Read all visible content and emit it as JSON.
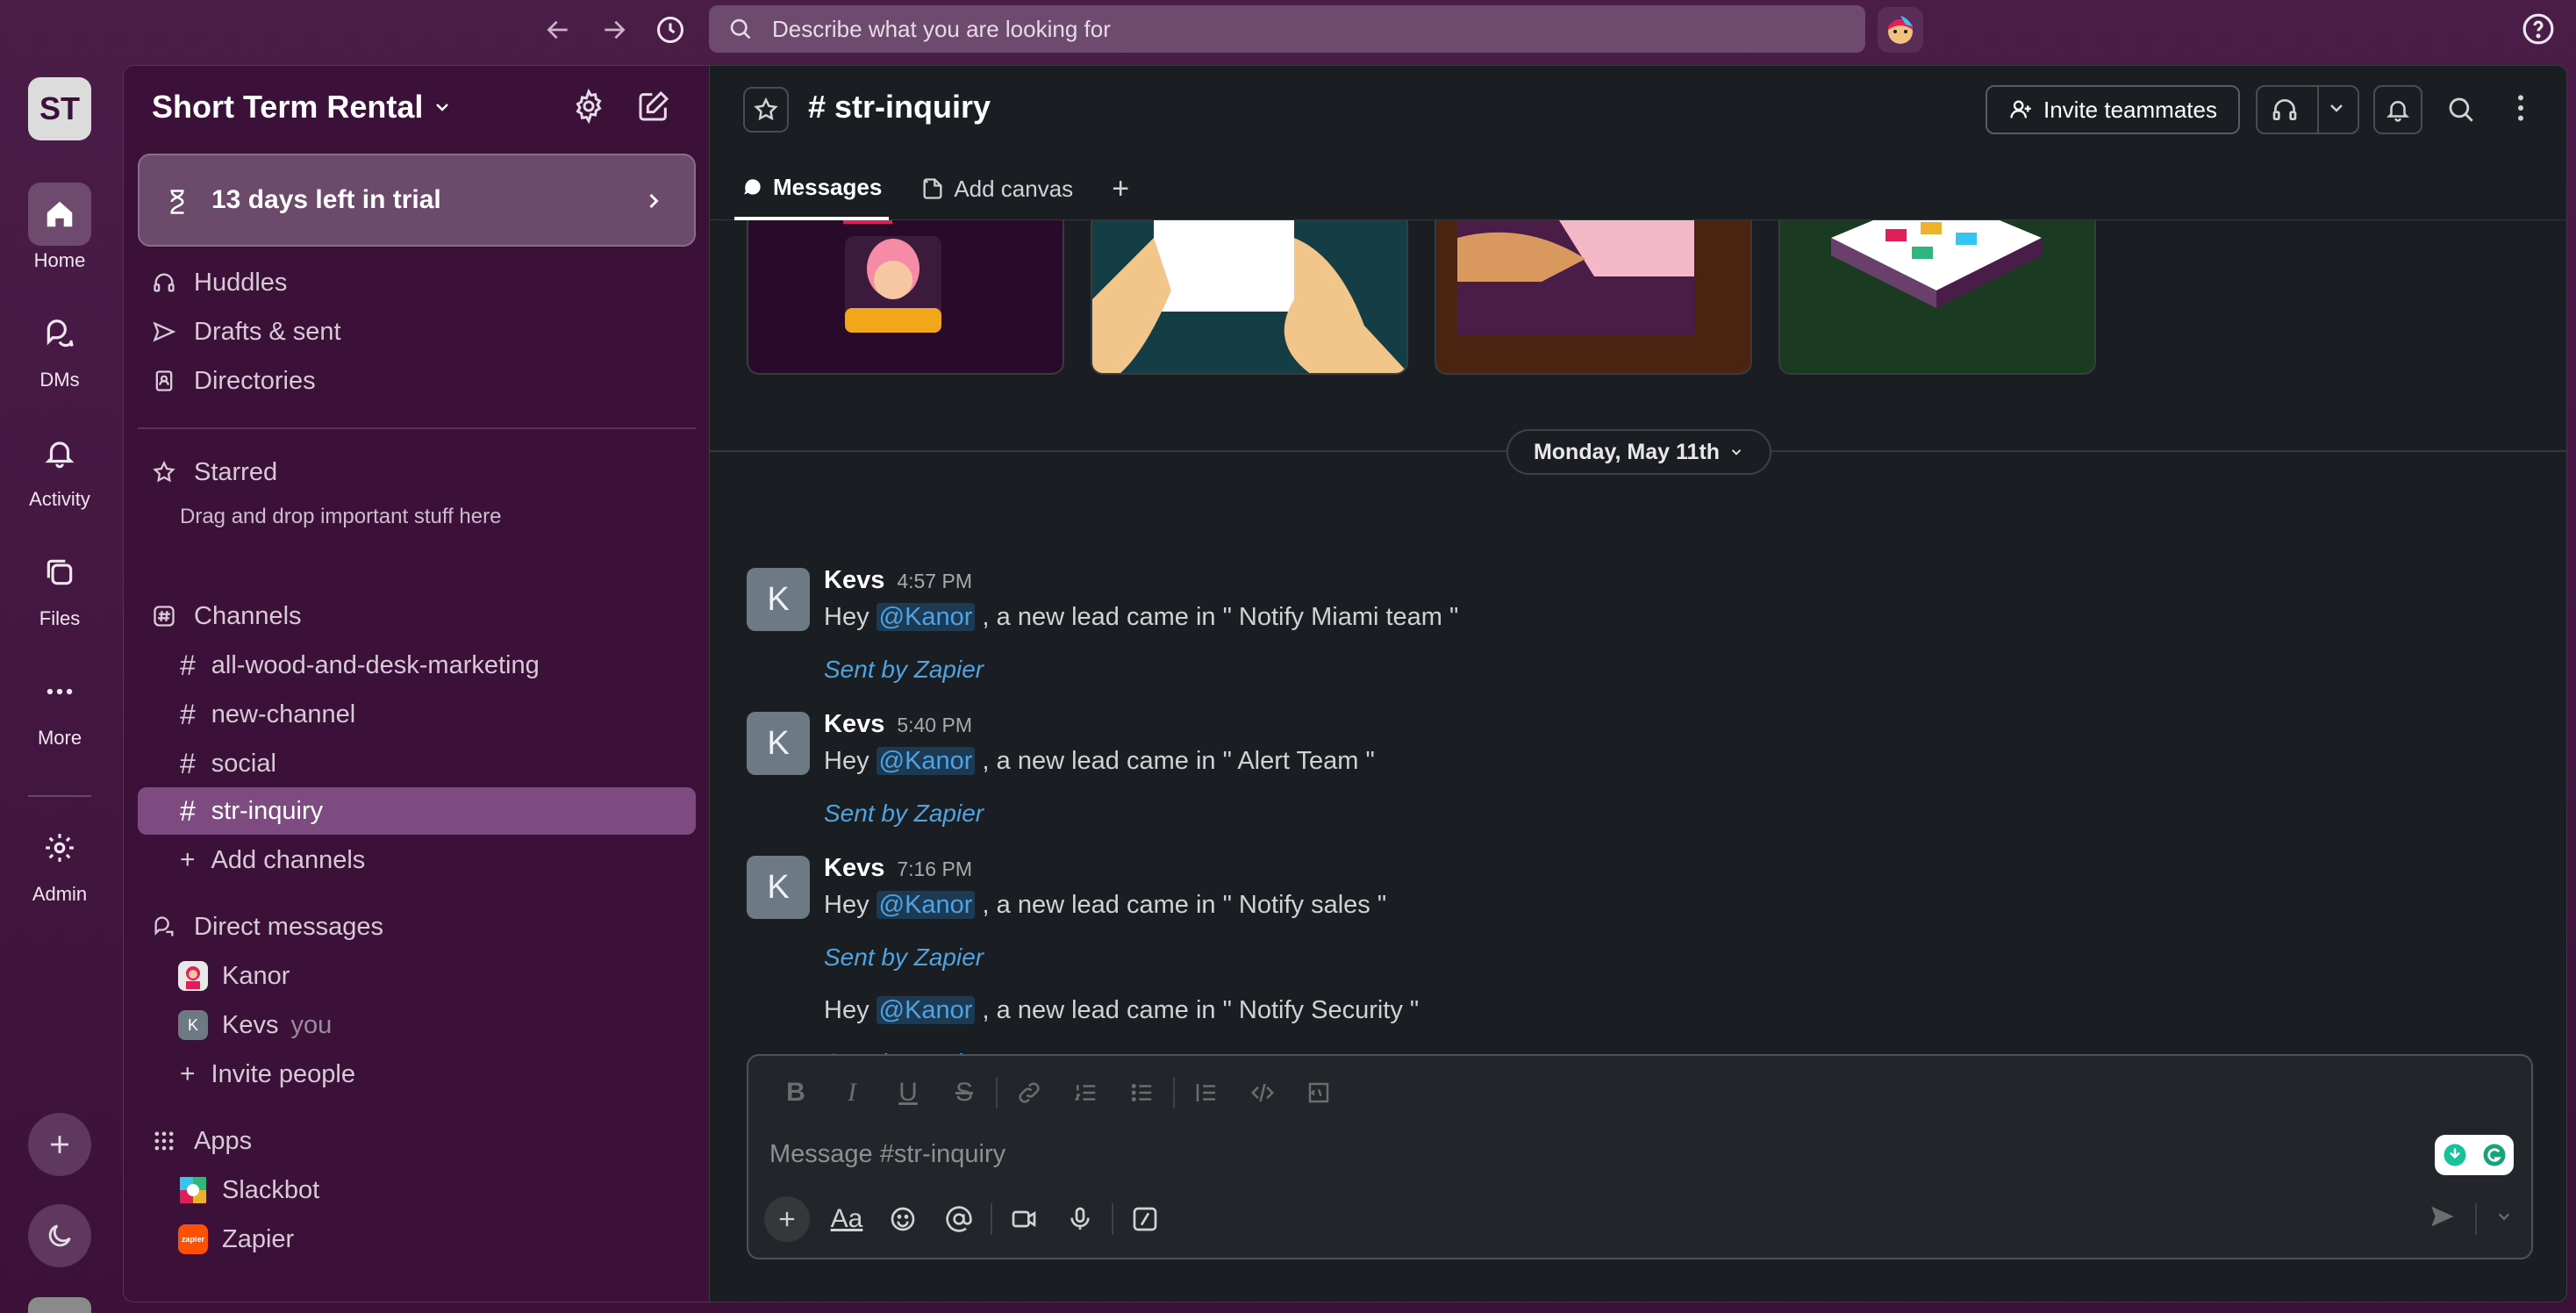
{
  "topbar": {
    "search_placeholder": "Describe what you are looking for"
  },
  "rail": {
    "workspace_initials": "ST",
    "items": [
      {
        "label": "Home",
        "icon": "home-icon"
      },
      {
        "label": "DMs",
        "icon": "dms-icon"
      },
      {
        "label": "Activity",
        "icon": "bell-icon"
      },
      {
        "label": "Files",
        "icon": "files-icon"
      },
      {
        "label": "More",
        "icon": "more-icon"
      },
      {
        "label": "Admin",
        "icon": "gear-icon"
      }
    ]
  },
  "sidebar": {
    "workspace_name": "Short Term Rental",
    "trial_text": "13 days left in trial",
    "nav": [
      {
        "label": "Huddles"
      },
      {
        "label": "Drafts & sent"
      },
      {
        "label": "Directories"
      }
    ],
    "starred_label": "Starred",
    "starred_note": "Drag and drop important stuff here",
    "channels_label": "Channels",
    "channels": [
      "all-wood-and-desk-marketing",
      "new-channel",
      "social",
      "str-inquiry"
    ],
    "add_channels_label": "Add channels",
    "dm_label": "Direct messages",
    "dms": [
      {
        "name": "Kanor",
        "suffix": ""
      },
      {
        "name": "Kevs",
        "suffix": "you",
        "avatar_letter": "K"
      }
    ],
    "invite_people_label": "Invite people",
    "apps_label": "Apps",
    "apps": [
      {
        "name": "Slackbot"
      },
      {
        "name": "Zapier",
        "logo_text": "zapier"
      }
    ]
  },
  "channel": {
    "name": "# str-inquiry",
    "invite_label": "Invite teammates",
    "tabs": [
      {
        "label": "Messages"
      },
      {
        "label": "Add canvas"
      }
    ],
    "tab_add": "+"
  },
  "date_divider": "Monday, May 11th",
  "messages": [
    {
      "avatar": "K",
      "author": "Kevs",
      "time": "4:57 PM",
      "pre": "Hey ",
      "mention": "@Kanor",
      "post": " , a new lead came in \" Notify Miami team \"",
      "sent_by": "Sent by Zapier"
    },
    {
      "avatar": "K",
      "author": "Kevs",
      "time": "5:40 PM",
      "pre": "Hey ",
      "mention": "@Kanor",
      "post": " , a new lead came in \" Alert Team \"",
      "sent_by": "Sent by Zapier"
    },
    {
      "avatar": "K",
      "author": "Kevs",
      "time": "7:16 PM",
      "pre": "Hey ",
      "mention": "@Kanor",
      "post": " , a new lead came in \" Notify sales \"",
      "sent_by": "Sent by Zapier"
    },
    {
      "pre": "Hey ",
      "mention": "@Kanor",
      "post": " , a new lead came in \" Notify Security \"",
      "sent_by": "Sent by Zapier"
    }
  ],
  "composer": {
    "placeholder": "Message #str-inquiry",
    "text_format_label": "Aa"
  },
  "colors": {
    "aubergine": "#3b1139",
    "active_channel": "#7e4b80",
    "main_bg": "#1a1d21",
    "link_blue": "#4fa3e0"
  }
}
